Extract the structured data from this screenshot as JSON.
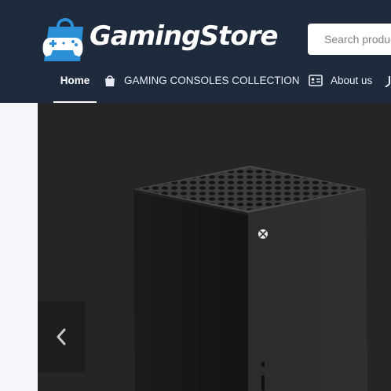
{
  "brand": {
    "name": "GamingStore",
    "logo_icon": "shopping-bag-gamepad-icon",
    "colors": {
      "header_bg": "#1f2b3d",
      "logo_blue": "#2a8fd6",
      "hero_bg": "#252525"
    }
  },
  "search": {
    "placeholder": "Search products"
  },
  "nav": {
    "home_label": "Home",
    "consoles_label": "GAMING CONSOLES COLLECTION",
    "consoles_icon": "shopping-bag-icon",
    "about_label": "About us",
    "about_icon": "id-card-icon",
    "extra_icon": "more-icon"
  },
  "hero": {
    "product_image": "xbox-series-x-console",
    "prev_icon": "chevron-left-icon"
  }
}
